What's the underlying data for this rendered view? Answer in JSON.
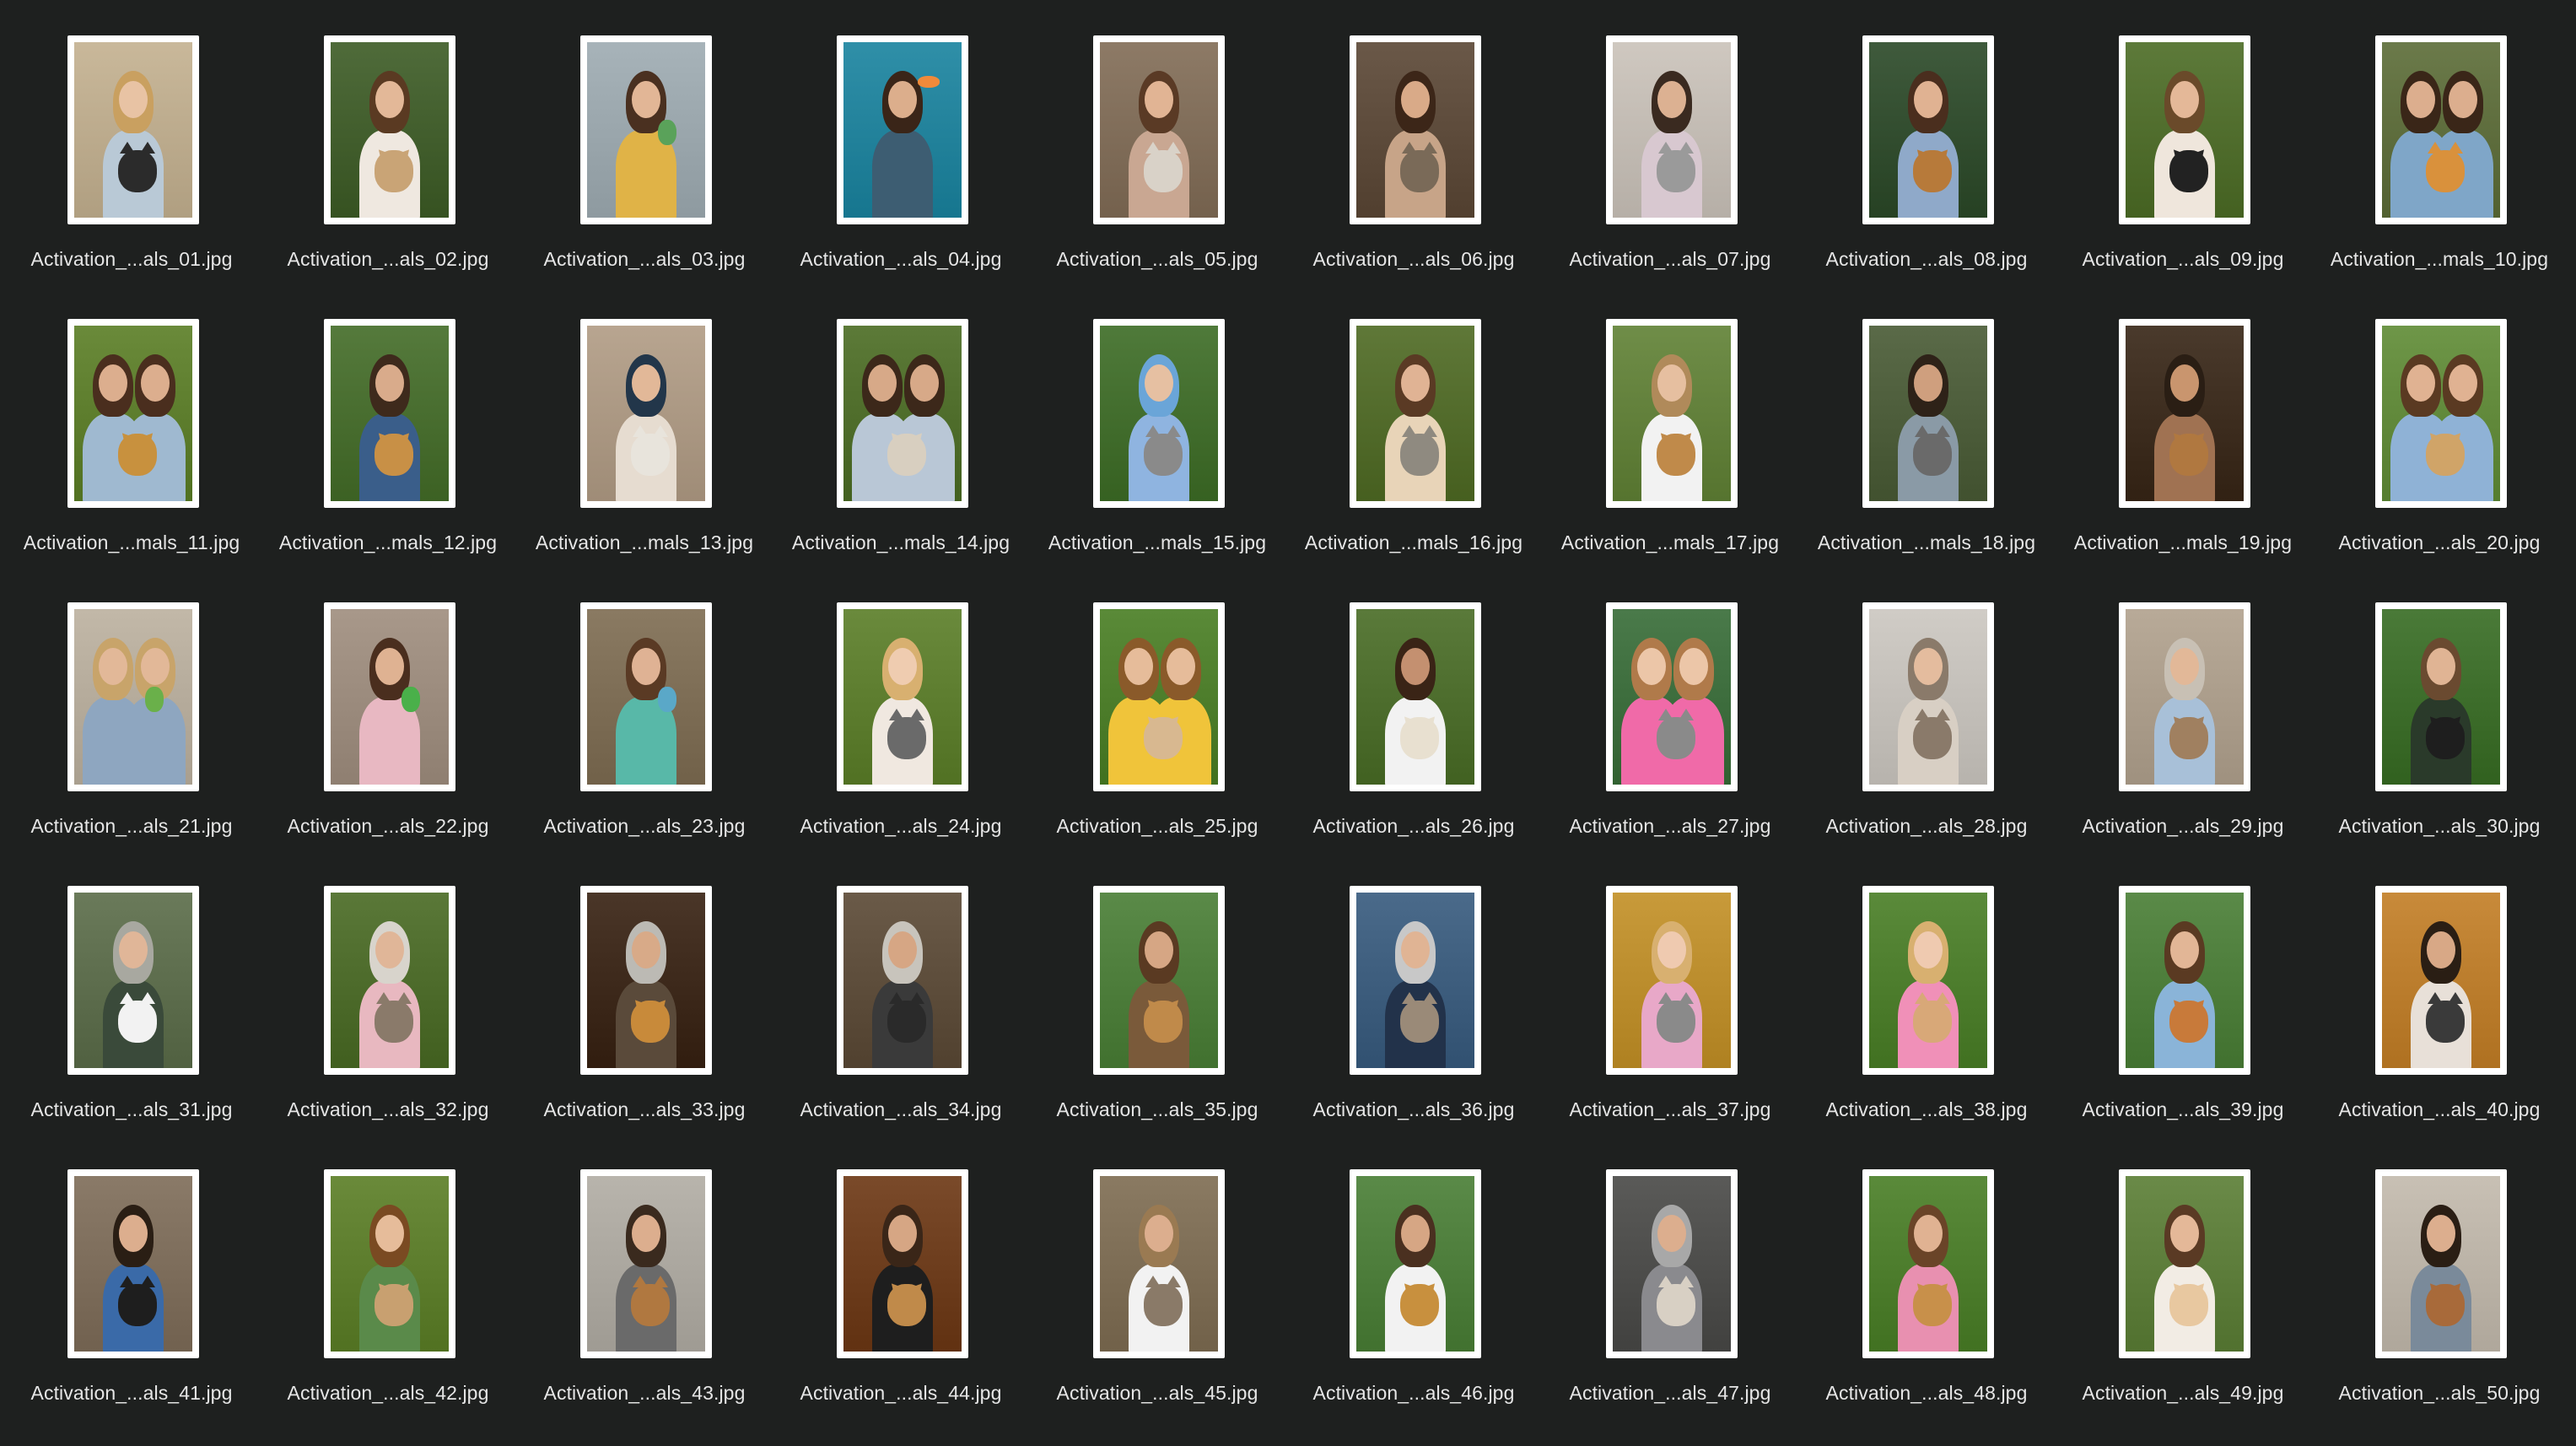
{
  "files": [
    {
      "name": "Activation_...als_01.jpg",
      "palette": {
        "bg": "#c9b89a",
        "hair": "#c9a060",
        "skin": "#e8c3a4",
        "top": "#b9c9d6",
        "animal": "#2b2b2b"
      },
      "people": 1,
      "animal": "cat"
    },
    {
      "name": "Activation_...als_02.jpg",
      "palette": {
        "bg": "#4f6b3a",
        "hair": "#5a3a22",
        "skin": "#e3b898",
        "top": "#efe8e0",
        "animal": "#c9a476"
      },
      "people": 1,
      "animal": "dog"
    },
    {
      "name": "Activation_...als_03.jpg",
      "palette": {
        "bg": "#a7b3b9",
        "hair": "#4a3020",
        "skin": "#e2b696",
        "top": "#e0b347",
        "animal": "#5aa25a"
      },
      "people": 1,
      "animal": "bird"
    },
    {
      "name": "Activation_...als_04.jpg",
      "palette": {
        "bg": "#2f8fa8",
        "hair": "#3a2518",
        "skin": "#dcae8c",
        "top": "#3d5d72",
        "animal": "#f08a3a"
      },
      "people": 1,
      "animal": "fish"
    },
    {
      "name": "Activation_...als_05.jpg",
      "palette": {
        "bg": "#8d7a66",
        "hair": "#5a3a25",
        "skin": "#e1b494",
        "top": "#c9a792",
        "animal": "#d9d2c8"
      },
      "people": 1,
      "animal": "cat"
    },
    {
      "name": "Activation_...als_06.jpg",
      "palette": {
        "bg": "#6a5848",
        "hair": "#3c2618",
        "skin": "#d9aa88",
        "top": "#c7a488",
        "animal": "#7a6a58"
      },
      "people": 1,
      "animal": "cat"
    },
    {
      "name": "Activation_...als_07.jpg",
      "palette": {
        "bg": "#cfc8c0",
        "hair": "#3a2a20",
        "skin": "#dcb192",
        "top": "#d8c8d0",
        "animal": "#9a9a9a"
      },
      "people": 1,
      "animal": "cat"
    },
    {
      "name": "Activation_...als_08.jpg",
      "palette": {
        "bg": "#3f5a3c",
        "hair": "#4a2e1e",
        "skin": "#e0b292",
        "top": "#8fa9c9",
        "animal": "#b77a3a"
      },
      "people": 1,
      "animal": "dog"
    },
    {
      "name": "Activation_...als_09.jpg",
      "palette": {
        "bg": "#5d7a3a",
        "hair": "#6a4a2a",
        "skin": "#e4b898",
        "top": "#efe6dc",
        "animal": "#222222"
      },
      "people": 1,
      "animal": "dog"
    },
    {
      "name": "Activation_...mals_10.jpg",
      "palette": {
        "bg": "#6b7a4a",
        "hair": "#3a2618",
        "skin": "#dcae8e",
        "top": "#7fa6c8",
        "animal": "#d9913c"
      },
      "people": 2,
      "animal": "cat"
    },
    {
      "name": "Activation_...mals_11.jpg",
      "palette": {
        "bg": "#6a8a3a",
        "hair": "#4a2e1e",
        "skin": "#dcae8e",
        "top": "#9fb9d0",
        "animal": "#c8913e"
      },
      "people": 2,
      "animal": "dog"
    },
    {
      "name": "Activation_...mals_12.jpg",
      "palette": {
        "bg": "#557a3c",
        "hair": "#3e2a1c",
        "skin": "#d9ab8b",
        "top": "#3a5e8a",
        "animal": "#c89046"
      },
      "people": 1,
      "animal": "dog"
    },
    {
      "name": "Activation_...mals_13.jpg",
      "palette": {
        "bg": "#b8a590",
        "hair": "#22364a",
        "skin": "#e2b898",
        "top": "#e6dcd0",
        "animal": "#e8e4dc"
      },
      "people": 1,
      "animal": "cat"
    },
    {
      "name": "Activation_...mals_14.jpg",
      "palette": {
        "bg": "#5c7a38",
        "hair": "#3c281a",
        "skin": "#d7a988",
        "top": "#b9c7d6",
        "animal": "#d8cfc0"
      },
      "people": 2,
      "animal": "dog"
    },
    {
      "name": "Activation_...mals_15.jpg",
      "palette": {
        "bg": "#4f7a3a",
        "hair": "#6aa5d8",
        "skin": "#e6c0a2",
        "top": "#8fb4e0",
        "animal": "#8a8a8a"
      },
      "people": 1,
      "animal": "cat"
    },
    {
      "name": "Activation_...mals_16.jpg",
      "palette": {
        "bg": "#5f7838",
        "hair": "#5a3a24",
        "skin": "#e0b394",
        "top": "#e8d4b8",
        "animal": "#8f8a80"
      },
      "people": 1,
      "animal": "cat"
    },
    {
      "name": "Activation_...mals_17.jpg",
      "palette": {
        "bg": "#6f8d48",
        "hair": "#b08a5a",
        "skin": "#e6bfa0",
        "top": "#f2f2f2",
        "animal": "#c08a4a"
      },
      "people": 1,
      "animal": "dog"
    },
    {
      "name": "Activation_...mals_18.jpg",
      "palette": {
        "bg": "#5a6a48",
        "hair": "#2e2218",
        "skin": "#cf9f7e",
        "top": "#8a9aa6",
        "animal": "#6a6a6a"
      },
      "people": 1,
      "animal": "cat"
    },
    {
      "name": "Activation_...mals_19.jpg",
      "palette": {
        "bg": "#4a3a2c",
        "hair": "#2a1e14",
        "skin": "#c9956e",
        "top": "#a07252",
        "animal": "#b07840"
      },
      "people": 1,
      "animal": "dog"
    },
    {
      "name": "Activation_...als_20.jpg",
      "palette": {
        "bg": "#6e9648",
        "hair": "#5a3a22",
        "skin": "#e0b292",
        "top": "#8fb2d6",
        "animal": "#d0a468"
      },
      "people": 2,
      "animal": "dog"
    },
    {
      "name": "Activation_...als_21.jpg",
      "palette": {
        "bg": "#c2b8a8",
        "hair": "#c8a46a",
        "skin": "#e2b898",
        "top": "#8ea6c0",
        "animal": "#6ab04a"
      },
      "people": 2,
      "animal": "bird"
    },
    {
      "name": "Activation_...als_22.jpg",
      "palette": {
        "bg": "#a8988a",
        "hair": "#4a2e1e",
        "skin": "#dfb292",
        "top": "#e8b8c2",
        "animal": "#4ab04a"
      },
      "people": 1,
      "animal": "bird"
    },
    {
      "name": "Activation_...als_23.jpg",
      "palette": {
        "bg": "#8a7a62",
        "hair": "#5a3a24",
        "skin": "#dfb294",
        "top": "#58b8a8",
        "animal": "#5aa8c8"
      },
      "people": 1,
      "animal": "bird"
    },
    {
      "name": "Activation_...als_24.jpg",
      "palette": {
        "bg": "#6a8a3c",
        "hair": "#d8b070",
        "skin": "#efccb0",
        "top": "#f0e8e0",
        "animal": "#6a6a6a"
      },
      "people": 1,
      "animal": "cat"
    },
    {
      "name": "Activation_...als_25.jpg",
      "palette": {
        "bg": "#5a8a38",
        "hair": "#8a5a2a",
        "skin": "#e6bc9a",
        "top": "#f0c43a",
        "animal": "#d8b890"
      },
      "people": 2,
      "animal": "dog"
    },
    {
      "name": "Activation_...als_26.jpg",
      "palette": {
        "bg": "#5a7a3a",
        "hair": "#3a2416",
        "skin": "#c49070",
        "top": "#f2f2f2",
        "animal": "#e8e0d0"
      },
      "people": 1,
      "animal": "dog"
    },
    {
      "name": "Activation_...als_27.jpg",
      "palette": {
        "bg": "#4a7a4a",
        "hair": "#b07a4a",
        "skin": "#ecc6a8",
        "top": "#f06aa8",
        "animal": "#8a8a8a"
      },
      "people": 2,
      "animal": "cat"
    },
    {
      "name": "Activation_...als_28.jpg",
      "palette": {
        "bg": "#d0ccc6",
        "hair": "#8a7a6a",
        "skin": "#e4bc9e",
        "top": "#d8cfc4",
        "animal": "#8a7a6a"
      },
      "people": 1,
      "animal": "cat"
    },
    {
      "name": "Activation_...als_29.jpg",
      "palette": {
        "bg": "#b8aa98",
        "hair": "#c8c0b4",
        "skin": "#e2b898",
        "top": "#a8c0d8",
        "animal": "#a08060"
      },
      "people": 1,
      "animal": "dog"
    },
    {
      "name": "Activation_...als_30.jpg",
      "palette": {
        "bg": "#4a7a38",
        "hair": "#6a4a30",
        "skin": "#e0b494",
        "top": "#2a3a2a",
        "animal": "#1e1e1e"
      },
      "people": 1,
      "animal": "dog"
    },
    {
      "name": "Activation_...als_31.jpg",
      "palette": {
        "bg": "#6a7a5a",
        "hair": "#a8a8a0",
        "skin": "#e0b698",
        "top": "#3a4a3a",
        "animal": "#f2f2f2"
      },
      "people": 1,
      "animal": "cat"
    },
    {
      "name": "Activation_...als_32.jpg",
      "palette": {
        "bg": "#5a7838",
        "hair": "#d8d4cc",
        "skin": "#e0b698",
        "top": "#e8b8c0",
        "animal": "#8a7a6a"
      },
      "people": 1,
      "animal": "cat"
    },
    {
      "name": "Activation_...als_33.jpg",
      "palette": {
        "bg": "#4a3628",
        "hair": "#bcbab4",
        "skin": "#d8aa88",
        "top": "#5a4a3a",
        "animal": "#c88a3a"
      },
      "people": 1,
      "animal": "dog"
    },
    {
      "name": "Activation_...als_34.jpg",
      "palette": {
        "bg": "#6a5a48",
        "hair": "#c8c4bc",
        "skin": "#d6a684",
        "top": "#3a3a3a",
        "animal": "#2a2a2a"
      },
      "people": 1,
      "animal": "cat"
    },
    {
      "name": "Activation_...als_35.jpg",
      "palette": {
        "bg": "#5a8a48",
        "hair": "#5a3a22",
        "skin": "#d6a684",
        "top": "#7a5a3a",
        "animal": "#c08a4a"
      },
      "people": 1,
      "animal": "dog"
    },
    {
      "name": "Activation_...als_36.jpg",
      "palette": {
        "bg": "#4a6a8a",
        "hair": "#c8c8c8",
        "skin": "#e0b494",
        "top": "#22324a",
        "animal": "#9a8a78"
      },
      "people": 1,
      "animal": "cat"
    },
    {
      "name": "Activation_...als_37.jpg",
      "palette": {
        "bg": "#c89a3a",
        "hair": "#d8b070",
        "skin": "#efcab0",
        "top": "#e8a8c8",
        "animal": "#8a8a8a"
      },
      "people": 1,
      "animal": "cat"
    },
    {
      "name": "Activation_...als_38.jpg",
      "palette": {
        "bg": "#5a8a3a",
        "hair": "#d8b070",
        "skin": "#efcab0",
        "top": "#f090b8",
        "animal": "#d8a878"
      },
      "people": 1,
      "animal": "cat"
    },
    {
      "name": "Activation_...als_39.jpg",
      "palette": {
        "bg": "#5a8a48",
        "hair": "#5a3a22",
        "skin": "#e2b696",
        "top": "#8ab4d8",
        "animal": "#c87a3a"
      },
      "people": 1,
      "animal": "dog"
    },
    {
      "name": "Activation_...als_40.jpg",
      "palette": {
        "bg": "#c88a3a",
        "hair": "#2a1e14",
        "skin": "#d8a886",
        "top": "#e8e0d8",
        "animal": "#3a3a3a"
      },
      "people": 1,
      "animal": "cat"
    },
    {
      "name": "Activation_...als_41.jpg",
      "palette": {
        "bg": "#8a7a68",
        "hair": "#2a1e14",
        "skin": "#dcae8e",
        "top": "#3a6aa8",
        "animal": "#1e1e1e"
      },
      "people": 1,
      "animal": "cat"
    },
    {
      "name": "Activation_...als_42.jpg",
      "palette": {
        "bg": "#6a8a3a",
        "hair": "#7a4a22",
        "skin": "#e6bc9a",
        "top": "#5a8a4a",
        "animal": "#c8a070"
      },
      "people": 1,
      "animal": "dog"
    },
    {
      "name": "Activation_...als_43.jpg",
      "palette": {
        "bg": "#b8b4ac",
        "hair": "#3a2a1e",
        "skin": "#dcae8e",
        "top": "#6a6a6a",
        "animal": "#b07840"
      },
      "people": 1,
      "animal": "cat"
    },
    {
      "name": "Activation_...als_44.jpg",
      "palette": {
        "bg": "#7a4a2a",
        "hair": "#3a2618",
        "skin": "#d6a684",
        "top": "#1e1e1e",
        "animal": "#c08a4a"
      },
      "people": 1,
      "animal": "dog"
    },
    {
      "name": "Activation_...als_45.jpg",
      "palette": {
        "bg": "#8a7a62",
        "hair": "#9a7a52",
        "skin": "#dcae8e",
        "top": "#f2f2f2",
        "animal": "#8a7a68"
      },
      "people": 1,
      "animal": "cat"
    },
    {
      "name": "Activation_...als_46.jpg",
      "palette": {
        "bg": "#5a8a48",
        "hair": "#4a3020",
        "skin": "#d6a684",
        "top": "#f2f2f2",
        "animal": "#c8903e"
      },
      "people": 1,
      "animal": "dog"
    },
    {
      "name": "Activation_...als_47.jpg",
      "palette": {
        "bg": "#5a5a58",
        "hair": "#a8a8a8",
        "skin": "#dcae8e",
        "top": "#8a8a8e",
        "animal": "#d8d0c4"
      },
      "people": 1,
      "animal": "cat"
    },
    {
      "name": "Activation_...als_48.jpg",
      "palette": {
        "bg": "#5a8a3a",
        "hair": "#6a4428",
        "skin": "#e0b292",
        "top": "#e890b0",
        "animal": "#c8904a"
      },
      "people": 1,
      "animal": "dog"
    },
    {
      "name": "Activation_...als_49.jpg",
      "palette": {
        "bg": "#6a8a48",
        "hair": "#5a3a24",
        "skin": "#e4b898",
        "top": "#f2ece4",
        "animal": "#e8c8a0"
      },
      "people": 1,
      "animal": "dog"
    },
    {
      "name": "Activation_...als_50.jpg",
      "palette": {
        "bg": "#c8c0b4",
        "hair": "#2a1e14",
        "skin": "#dcae8e",
        "top": "#7a8a9a",
        "animal": "#a86a3a"
      },
      "people": 1,
      "animal": "dog"
    }
  ]
}
